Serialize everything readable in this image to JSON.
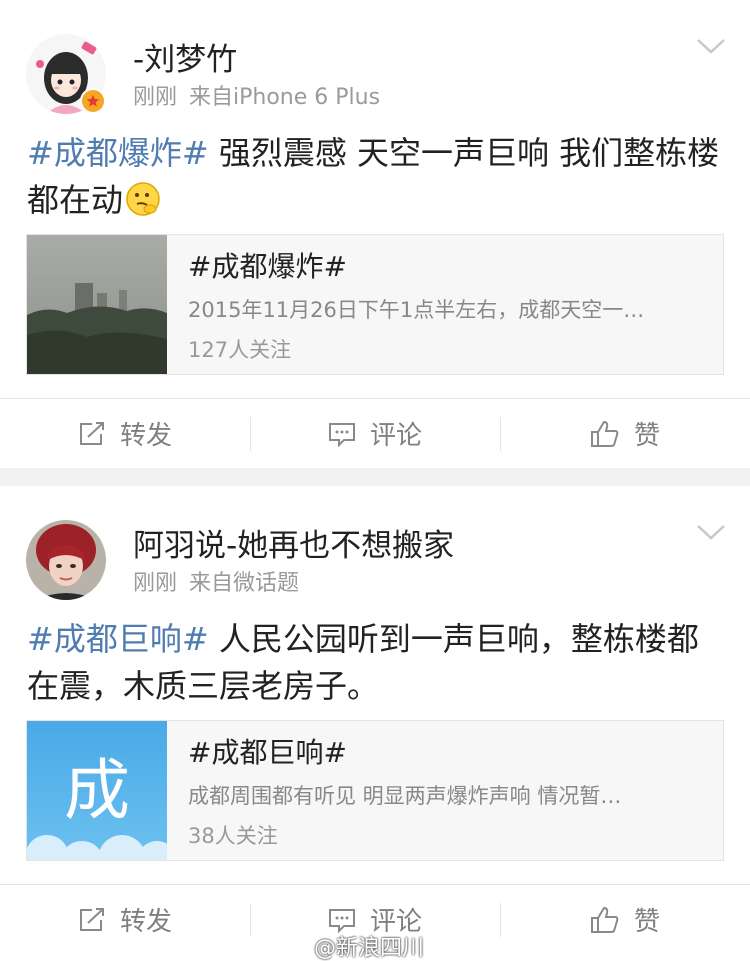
{
  "posts": [
    {
      "username": "-刘梦竹",
      "time": "刚刚",
      "source": "来自iPhone 6 Plus",
      "hashtag": "#成都爆炸#",
      "text": " 强烈震感 天空一声巨响 我们整栋楼都在动",
      "emoji_icon": "thinking-face-icon",
      "card": {
        "title": "#成都爆炸#",
        "desc": "2015年11月26日下午1点半左右，成都天空一…",
        "count": "127人关注"
      },
      "actions": {
        "repost": "转发",
        "comment": "评论",
        "like": "赞"
      }
    },
    {
      "username": "阿羽说-她再也不想搬家",
      "time": "刚刚",
      "source": "来自微话题",
      "hashtag": "#成都巨响#",
      "text": " 人民公园听到一声巨响，整栋楼都在震，木质三层老房子。",
      "card": {
        "title": "#成都巨响#",
        "thumb_char": "成",
        "desc": "成都周围都有听见 明显两声爆炸声响 情况暂…",
        "count": "38人关注"
      },
      "actions": {
        "repost": "转发",
        "comment": "评论",
        "like": "赞"
      }
    }
  ],
  "watermark": "@新浪四川",
  "colors": {
    "hashtag": "#507daf",
    "topic_thumb": "#5bb6ec",
    "badge": "#f5a623"
  }
}
